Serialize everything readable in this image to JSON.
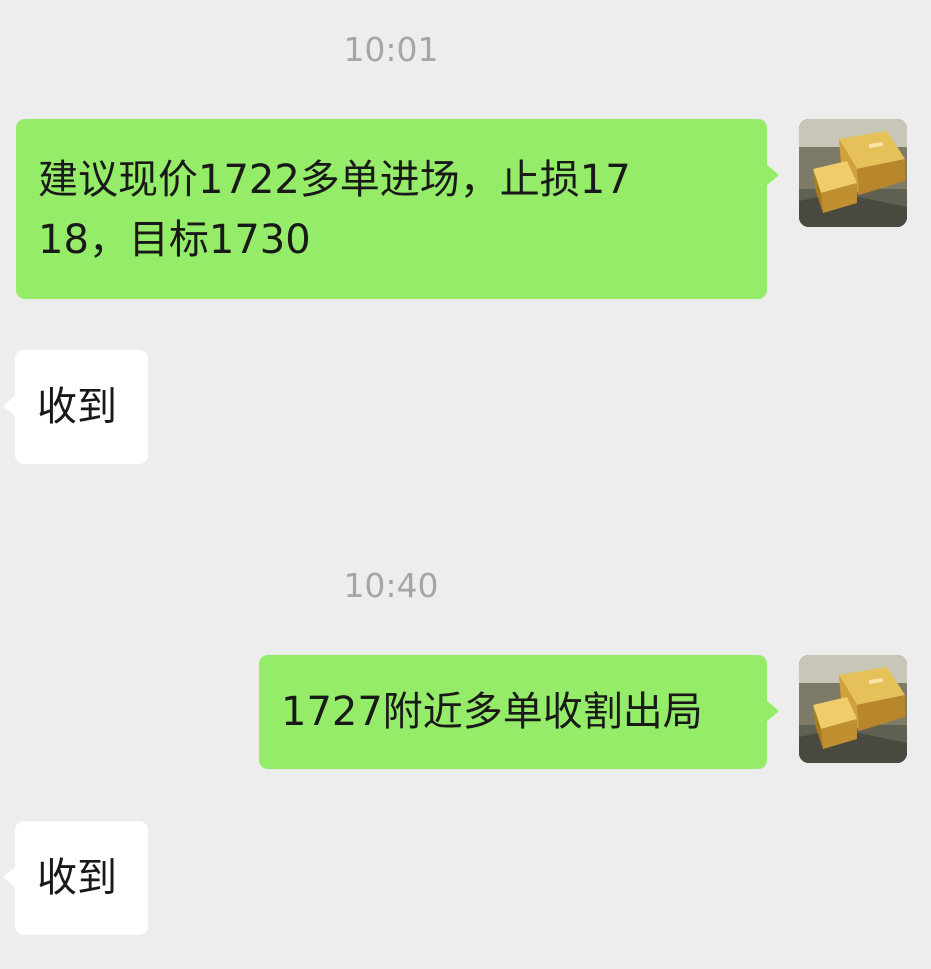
{
  "chat": {
    "timestamps": [
      "10:01",
      "10:40"
    ],
    "messages": [
      {
        "side": "sent",
        "text": "建议现价1722多单进场，止损1718，目标1730"
      },
      {
        "side": "received",
        "text": "收到"
      },
      {
        "side": "sent",
        "text": "1727附近多单收割出局"
      },
      {
        "side": "received",
        "text": "收到"
      }
    ],
    "avatar": {
      "icon": "gold-bar-avatar-icon"
    }
  },
  "colors": {
    "background": "#ededed",
    "sent_bubble": "#95ec69",
    "received_bubble": "#ffffff",
    "timestamp_text": "#a6a6a6",
    "message_text": "#191919"
  }
}
